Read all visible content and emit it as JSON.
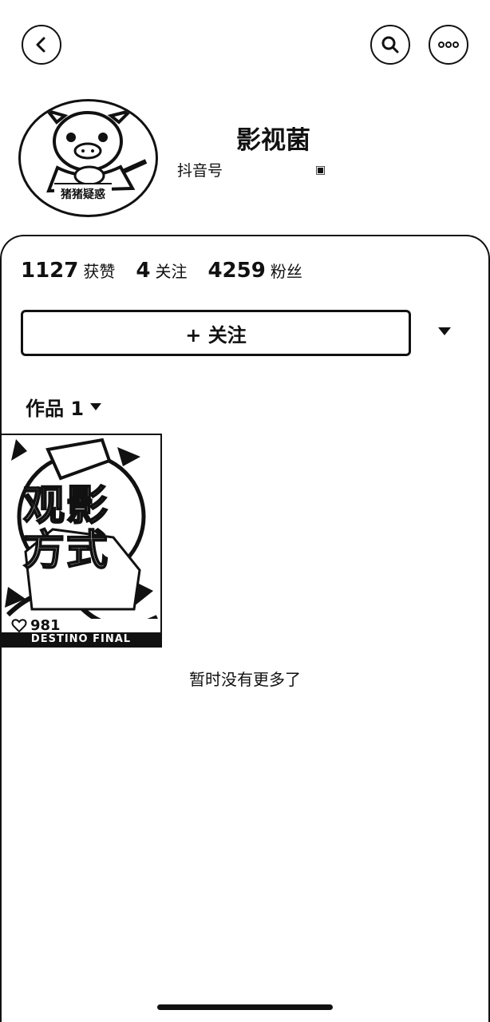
{
  "header": {
    "back_icon": "chevron-left-icon",
    "search_icon": "search-icon",
    "more_icon": "more-icon"
  },
  "profile": {
    "name": "影视菌",
    "avatar_badge": "猪猪疑惑",
    "douyin_id_label": "抖音号"
  },
  "stats": [
    {
      "value": "1127",
      "label": "获赞"
    },
    {
      "value": "4",
      "label": "关注"
    },
    {
      "value": "4259",
      "label": "粉丝"
    }
  ],
  "follow_button": {
    "label": "+ 关注"
  },
  "works": {
    "tab_label": "作品 1",
    "video": {
      "title_line1": "观影",
      "title_line2": "方式",
      "likes": "981",
      "footer_text": "DESTINO FINAL"
    }
  },
  "end_message": "暂时没有更多了"
}
